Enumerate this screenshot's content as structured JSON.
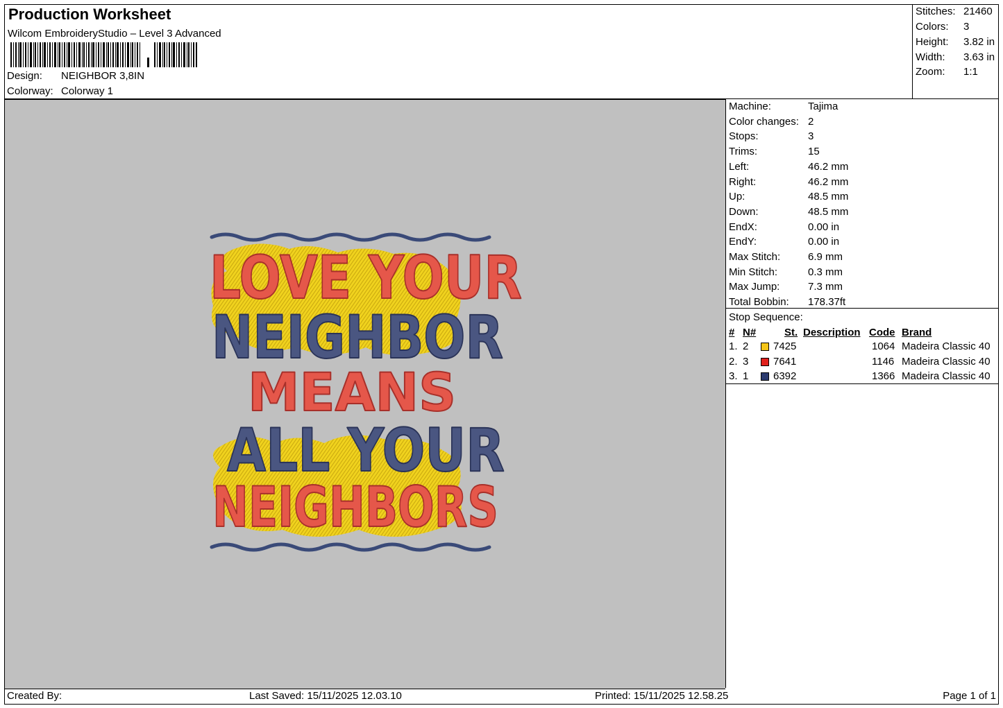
{
  "header": {
    "title": "Production Worksheet",
    "software": "Wilcom EmbroideryStudio – Level 3 Advanced",
    "design_label": "Design:",
    "design_value": "NEIGHBOR 3,8IN",
    "colorway_label": "Colorway:",
    "colorway_value": "Colorway 1"
  },
  "summary": {
    "stitches_label": "Stitches:",
    "stitches": "21460",
    "colors_label": "Colors:",
    "colors": "3",
    "height_label": "Height:",
    "height": "3.82 in",
    "width_label": "Width:",
    "width": "3.63 in",
    "zoom_label": "Zoom:",
    "zoom": "1:1"
  },
  "design_text": {
    "line1": "LOVE YOUR",
    "line2": "NEIGHBOR",
    "line3": "MEANS",
    "line4": "ALL YOUR",
    "line5": "NEIGHBORS"
  },
  "machine_info": [
    {
      "label": "Machine:",
      "value": "Tajima"
    },
    {
      "label": "Color changes:",
      "value": "2"
    },
    {
      "label": "Stops:",
      "value": "3"
    },
    {
      "label": "Trims:",
      "value": "15"
    },
    {
      "label": "Left:",
      "value": "46.2 mm"
    },
    {
      "label": "Right:",
      "value": "46.2 mm"
    },
    {
      "label": "Up:",
      "value": "48.5 mm"
    },
    {
      "label": "Down:",
      "value": "48.5 mm"
    },
    {
      "label": "EndX:",
      "value": "0.00 in"
    },
    {
      "label": "EndY:",
      "value": "0.00 in"
    },
    {
      "label": "Max Stitch:",
      "value": "6.9 mm"
    },
    {
      "label": "Min Stitch:",
      "value": "0.3 mm"
    },
    {
      "label": "Max Jump:",
      "value": "7.3 mm"
    },
    {
      "label": "Total Bobbin:",
      "value": "178.37ft"
    }
  ],
  "stop_sequence": {
    "caption": "Stop Sequence:",
    "headers": {
      "num": "#",
      "n": "N#",
      "st": "St.",
      "description": "Description",
      "code": "Code",
      "brand": "Brand"
    },
    "rows": [
      {
        "num": "1.",
        "n": "2",
        "color": "#f5c518",
        "st": "7425",
        "code": "1064",
        "brand": "Madeira Classic 40"
      },
      {
        "num": "2.",
        "n": "3",
        "color": "#e0201c",
        "st": "7641",
        "code": "1146",
        "brand": "Madeira Classic 40"
      },
      {
        "num": "3.",
        "n": "1",
        "color": "#2a3a6e",
        "st": "6392",
        "code": "1366",
        "brand": "Madeira Classic 40"
      }
    ]
  },
  "footer": {
    "created_by": "Created By:",
    "last_saved": "Last Saved: 15/11/2025 12.03.10",
    "printed": "Printed: 15/11/2025 12.58.25",
    "page": "Page 1 of 1"
  }
}
